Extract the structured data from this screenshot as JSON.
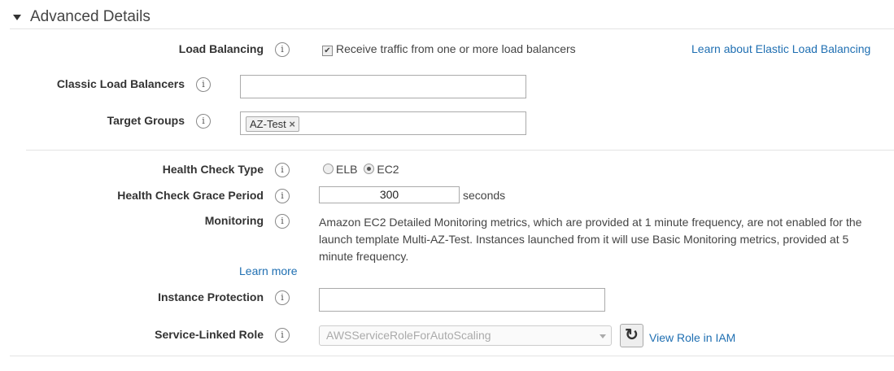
{
  "section": {
    "title": "Advanced Details"
  },
  "load_balancing": {
    "label": "Load Balancing",
    "checkbox_label": "Receive traffic from one or more load balancers",
    "checked": true,
    "learn_link": "Learn about Elastic Load Balancing"
  },
  "classic_lb": {
    "label": "Classic Load Balancers",
    "value": ""
  },
  "target_groups": {
    "label": "Target Groups",
    "tags": [
      "AZ-Test"
    ],
    "remove_glyph": "×"
  },
  "health_check_type": {
    "label": "Health Check Type",
    "options": [
      "ELB",
      "EC2"
    ],
    "selected": "EC2"
  },
  "grace_period": {
    "label": "Health Check Grace Period",
    "value": "300",
    "unit": "seconds"
  },
  "monitoring": {
    "label": "Monitoring",
    "text": "Amazon EC2 Detailed Monitoring metrics, which are provided at 1 minute frequency, are not enabled for the launch template Multi-AZ-Test. Instances launched from it will use Basic Monitoring metrics, provided at 5 minute frequency.",
    "learn_more": "Learn more"
  },
  "instance_protection": {
    "label": "Instance Protection",
    "value": ""
  },
  "service_role": {
    "label": "Service-Linked Role",
    "value": "AWSServiceRoleForAutoScaling",
    "view_link": "View Role in IAM"
  },
  "info_glyph": "i"
}
